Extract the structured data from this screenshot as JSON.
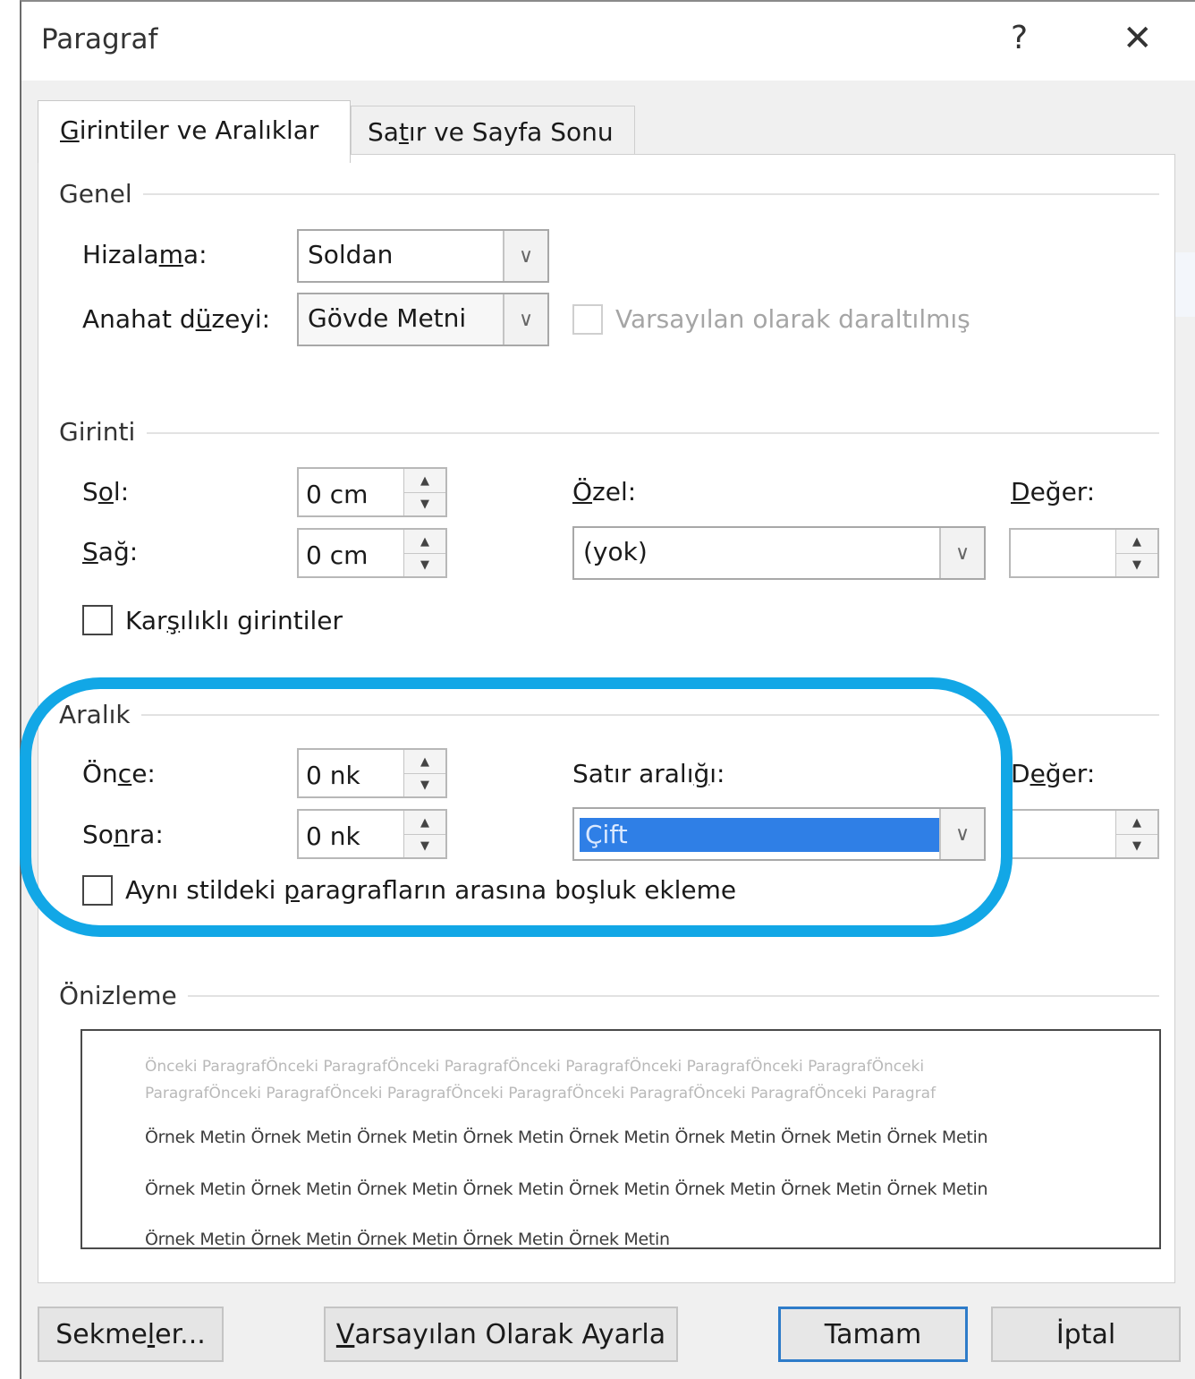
{
  "window": {
    "title": "Paragraf",
    "help_glyph": "?",
    "close_glyph": "✕"
  },
  "tabs": [
    {
      "label": "Girintiler ve Aralıklar",
      "accel": "G",
      "rest": "irintiler ve Aralıklar",
      "active": true
    },
    {
      "label": "Satır ve Sayfa Sonu",
      "pre": "Sa",
      "accel": "t",
      "rest": "ır ve Sayfa Sonu",
      "active": false
    }
  ],
  "genel": {
    "heading": "Genel",
    "hizalama": {
      "pre": "Hizala",
      "accel": "m",
      "post": "a:",
      "value": "Soldan"
    },
    "anahat": {
      "pre": "Anahat d",
      "accel": "ü",
      "post": "zeyi:",
      "value": "Gövde Metni"
    },
    "collapsed_checkbox": {
      "label": "Varsayılan olarak daraltılmış",
      "checked": false,
      "enabled": false
    }
  },
  "girinti": {
    "heading": "Girinti",
    "sol": {
      "pre": "S",
      "accel": "o",
      "post": "l:",
      "value": "0 cm"
    },
    "sag": {
      "pre": "",
      "accel": "S",
      "post": "ağ:",
      "value": "0 cm"
    },
    "ozel": {
      "pre": "",
      "accel": "Ö",
      "post": "zel:",
      "value": "(yok)"
    },
    "deger": {
      "pre": "",
      "accel": "D",
      "post": "eğer:",
      "value": ""
    },
    "mirror_checkbox": {
      "pre": "Kar",
      "accel": "ş",
      "post": "ılıklı girintiler",
      "checked": false
    }
  },
  "aralik": {
    "heading": "Aralık",
    "once": {
      "pre": "Ön",
      "accel": "c",
      "post": "e:",
      "value": "0 nk"
    },
    "sonra": {
      "pre": "So",
      "accel": "n",
      "post": "ra:",
      "value": "0 nk"
    },
    "satir_araligi": {
      "pre": "Satır aralı",
      "accel": "ğ",
      "post": "ı:",
      "value": "Çift"
    },
    "deger": {
      "pre": "D",
      "accel": "e",
      "post": "ğer:",
      "value": ""
    },
    "no_space_checkbox": {
      "pre": "Aynı stildeki ",
      "accel": "p",
      "post": "aragrafların arasına boşluk ekleme",
      "checked": false
    }
  },
  "onizleme": {
    "heading": "Önizleme",
    "previous_lines": [
      "Önceki ParagrafÖnceki ParagrafÖnceki ParagrafÖnceki ParagrafÖnceki ParagrafÖnceki ParagrafÖnceki",
      "ParagrafÖnceki ParagrafÖnceki ParagrafÖnceki ParagrafÖnceki ParagrafÖnceki ParagrafÖnceki Paragraf"
    ],
    "sample_lines": [
      "Örnek Metin Örnek Metin Örnek Metin Örnek Metin Örnek Metin Örnek Metin Örnek Metin Örnek Metin",
      "Örnek Metin Örnek Metin Örnek Metin Örnek Metin Örnek Metin Örnek Metin Örnek Metin Örnek Metin",
      "Örnek Metin Örnek Metin Örnek Metin Örnek Metin Örnek Metin"
    ]
  },
  "buttons": {
    "sekmeler": {
      "pre": "Sekme",
      "accel": "l",
      "post": "er..."
    },
    "varsayilan": {
      "pre": "",
      "accel": "V",
      "post": "arsayılan Olarak Ayarla"
    },
    "tamam": "Tamam",
    "iptal": "İptal"
  },
  "colors": {
    "highlight_ring": "#12a7e6",
    "selection": "#2f7fe6",
    "default_button_border": "#2e7cc9"
  }
}
